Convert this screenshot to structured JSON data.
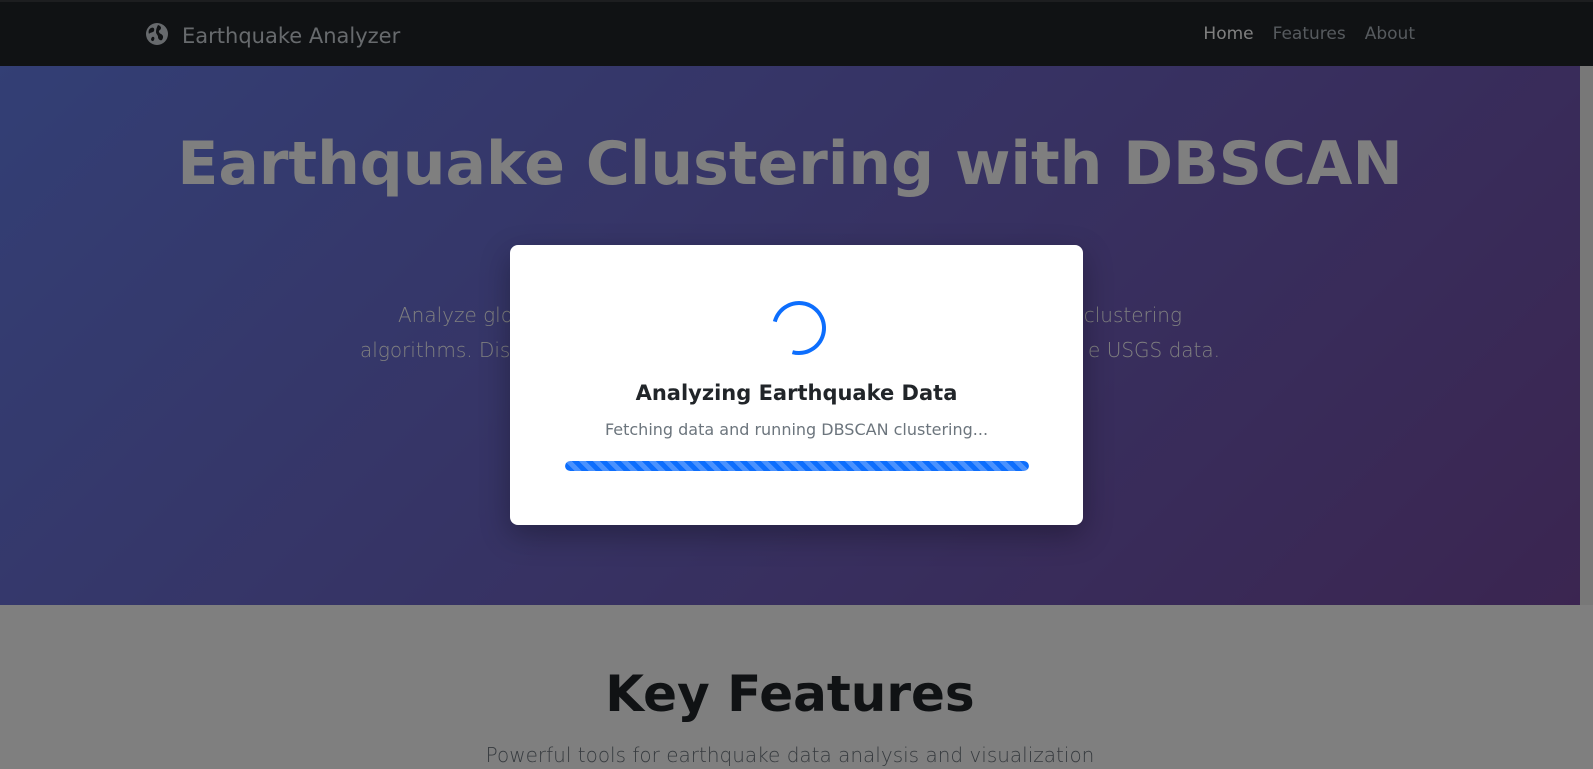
{
  "navbar": {
    "brand": "Earthquake Analyzer",
    "brand_icon": "globe-icon",
    "links": [
      "Home",
      "Features",
      "About"
    ]
  },
  "hero": {
    "title": "Earthquake Clustering with DBSCAN",
    "subtitle_visible_left_1": "Analyze glo",
    "subtitle_visible_right_1": "clustering",
    "subtitle_visible_left_2": "algorithms. Dis",
    "subtitle_visible_right_2": "e USGS data."
  },
  "features": {
    "title": "Key Features",
    "subtitle": "Powerful tools for earthquake data analysis and visualization"
  },
  "modal": {
    "title": "Analyzing Earthquake Data",
    "message": "Fetching data and running DBSCAN clustering...",
    "progress": 1.0
  },
  "colors": {
    "navbar_bg": "#212529",
    "accent": "#0d6efd",
    "hero_gradient_start": "#667eea",
    "hero_gradient_end": "#764ba2"
  }
}
